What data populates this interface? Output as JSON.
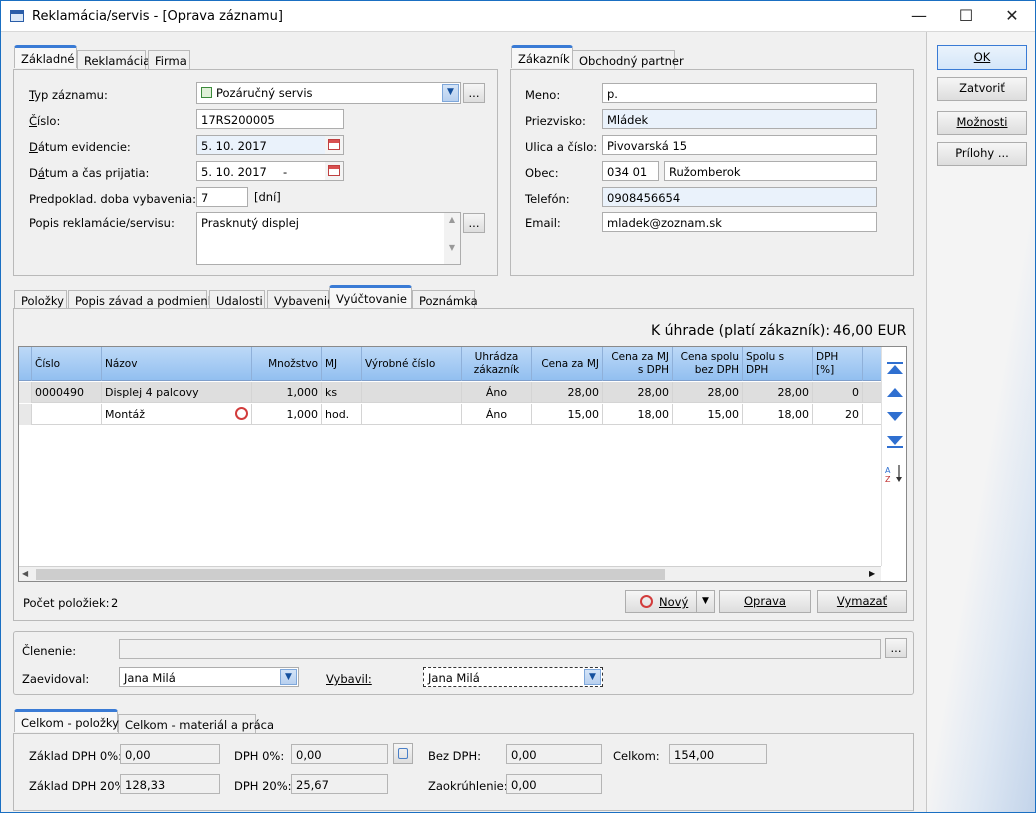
{
  "window": {
    "title": "Reklamácia/servis - [Oprava záznamu]"
  },
  "tabs_top_left": [
    {
      "label": "Základné",
      "active": true
    },
    {
      "label": "Reklamácia"
    },
    {
      "label": "Firma"
    }
  ],
  "basic": {
    "typ_label": "Typ záznamu:",
    "typ_value": "Pozáručný servis",
    "cislo_label": "Číslo:",
    "cislo_value": "17RS200005",
    "datum_ev_label": "Dátum evidencie:",
    "datum_ev_value": "5. 10. 2017",
    "datum_prij_label": "Dátum a čas prijatia:",
    "datum_prij_value": "5. 10. 2017",
    "datum_prij_time": "-",
    "doba_label": "Predpoklad. doba vybavenia:",
    "doba_value": "7",
    "doba_unit": "[dní]",
    "popis_label": "Popis reklamácie/servisu:",
    "popis_value": "Prasknutý displej",
    "more": "..."
  },
  "tabs_top_right": [
    {
      "label": "Zákazník",
      "active": true
    },
    {
      "label": "Obchodný partner"
    }
  ],
  "customer": {
    "meno_label": "Meno:",
    "meno_value": "p.",
    "priezvisko_label": "Priezvisko:",
    "priezvisko_value": "Mládek",
    "ulica_label": "Ulica a číslo:",
    "ulica_value": "Pivovarská 15",
    "obec_label": "Obec:",
    "psc_value": "034 01",
    "obec_value": "Ružomberok",
    "telefon_label": "Telefón:",
    "telefon_value": "0908456654",
    "email_label": "Email:",
    "email_value": "mladek@zoznam.sk"
  },
  "buttons_right": {
    "ok": "OK",
    "zatvorit": "Zatvoriť",
    "moznosti": "Možnosti",
    "prilohy": "Prílohy ..."
  },
  "tabs_mid": [
    {
      "label": "Položky"
    },
    {
      "label": "Popis závad a podmienky"
    },
    {
      "label": "Udalosti"
    },
    {
      "label": "Vybavenie"
    },
    {
      "label": "Vyúčtovanie",
      "active": true
    },
    {
      "label": "Poznámka"
    }
  ],
  "billing": {
    "k_uhrade_label": "K úhrade (platí zákazník):",
    "k_uhrade_value": "46,00 EUR",
    "columns": [
      "Číslo",
      "Názov",
      "Množstvo",
      "MJ",
      "Výrobné číslo",
      "Uhrádza zákazník",
      "Cena za MJ",
      "Cena za MJ s DPH",
      "Cena spolu bez DPH",
      "Spolu s DPH",
      "DPH [%]"
    ],
    "rows": [
      [
        "0000490",
        "Displej 4 palcovy",
        "1,000",
        "ks",
        "",
        "Áno",
        "28,00",
        "28,00",
        "28,00",
        "28,00",
        "0"
      ],
      [
        "",
        "Montáž",
        "1,000",
        "hod.",
        "",
        "Áno",
        "15,00",
        "18,00",
        "15,00",
        "18,00",
        "20"
      ]
    ],
    "pocet_label": "Počet položiek:",
    "pocet_value": "2",
    "novy": "Nový",
    "oprava": "Oprava",
    "vymazat": "Vymazať"
  },
  "footer": {
    "clenenie_label": "Členenie:",
    "clenenie_value": "",
    "zaevidoval_label": "Zaevidoval:",
    "zaevidoval_value": "Jana Milá",
    "vybavil_label": "Vybavil:",
    "vybavil_value": "Jana Milá"
  },
  "tabs_bottom": [
    {
      "label": "Celkom - položky",
      "active": true
    },
    {
      "label": "Celkom - materiál a práca"
    }
  ],
  "totals": {
    "zaklad0_label": "Základ DPH 0%:",
    "zaklad0_value": "0,00",
    "dph0_label": "DPH 0%:",
    "dph0_value": "0,00",
    "bezdph_label": "Bez DPH:",
    "bezdph_value": "0,00",
    "celkom_label": "Celkom:",
    "celkom_value": "154,00",
    "zaklad20_label": "Základ DPH 20%:",
    "zaklad20_value": "128,33",
    "dph20_label": "DPH 20%:",
    "dph20_value": "25,67",
    "zaokr_label": "Zaokrúhlenie:",
    "zaokr_value": "0,00"
  }
}
